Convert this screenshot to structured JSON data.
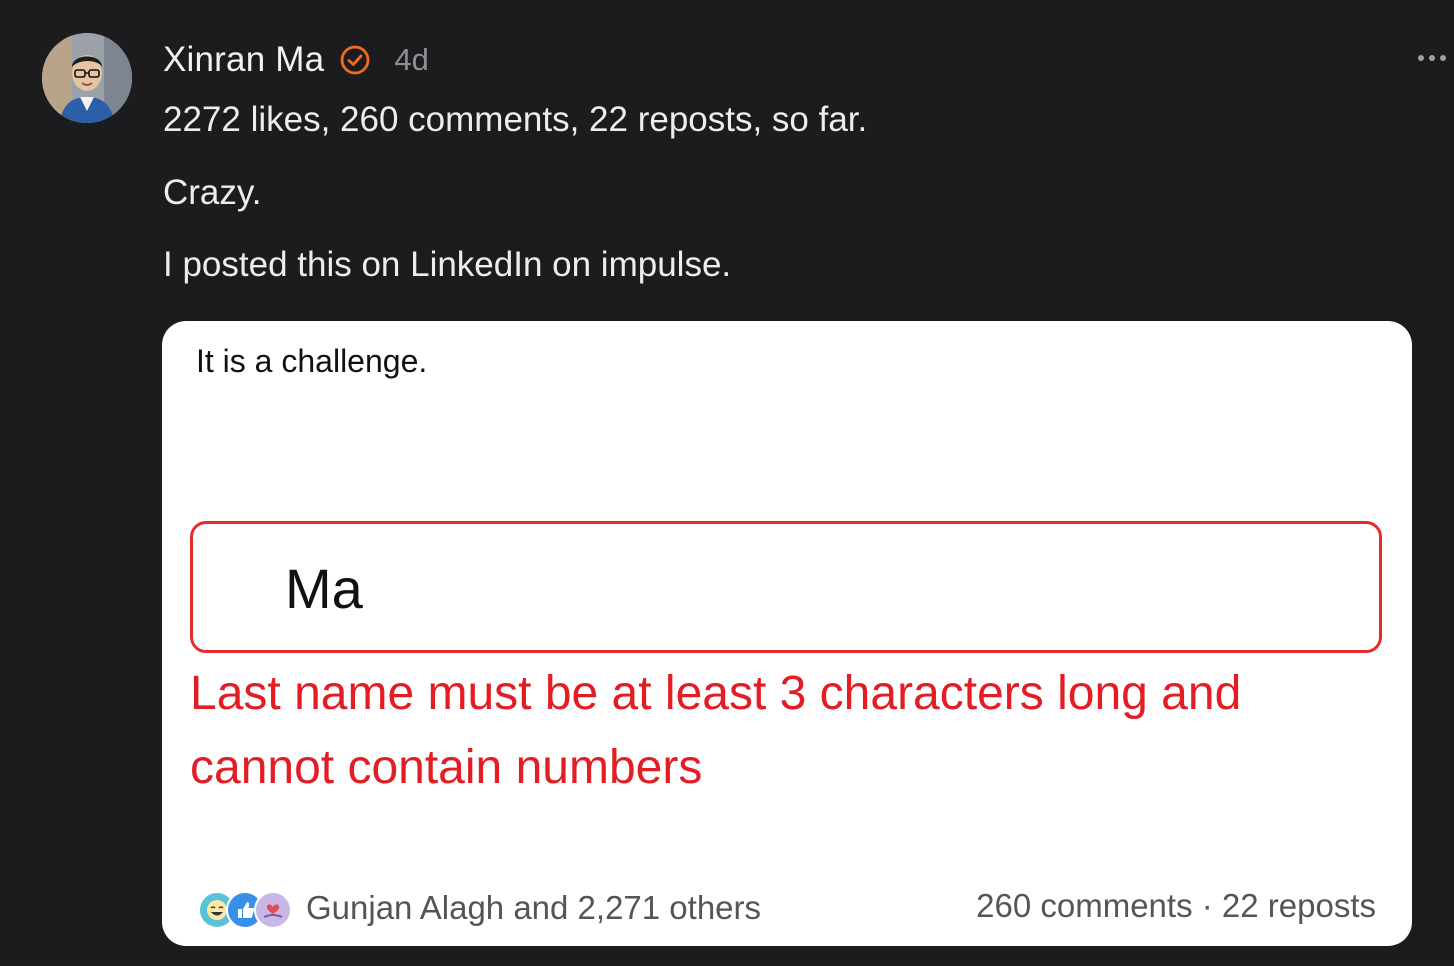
{
  "post": {
    "author": "Xinran Ma",
    "age": "4d",
    "lines": [
      "2272 likes, 260 comments, 22 reposts, so far.",
      "Crazy.",
      "I posted this on LinkedIn on impulse."
    ]
  },
  "card": {
    "caption": "It is a challenge.",
    "field_value": "Ma",
    "error": "Last name must be at least 3 characters long and cannot contain numbers",
    "reactions_text": "Gunjan Alagh and 2,271 others",
    "engagement_text": "260 comments · 22 reposts"
  },
  "icons": {
    "verified": "verified-badge-icon",
    "more": "more-options-icon",
    "reactions": [
      "funny-reaction-icon",
      "like-reaction-icon",
      "love-reaction-icon"
    ]
  },
  "colors": {
    "background": "#1c1c1e",
    "verified": "#f26b1d",
    "error": "#e21d24",
    "like": "#378fe9"
  }
}
